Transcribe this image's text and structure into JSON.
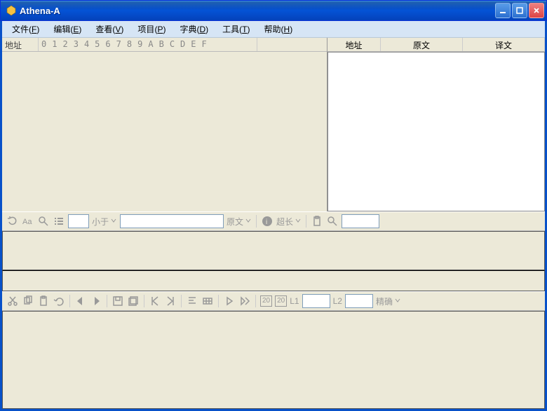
{
  "window": {
    "title": "Athena-A"
  },
  "menu": {
    "file": "文件",
    "file_k": "F",
    "edit": "编辑",
    "edit_k": "E",
    "view": "查看",
    "view_k": "V",
    "project": "项目",
    "project_k": "P",
    "dict": "字典",
    "dict_k": "D",
    "tools": "工具",
    "tools_k": "T",
    "help": "帮助",
    "help_k": "H"
  },
  "hex": {
    "address": "地址",
    "cols": [
      "0",
      "1",
      "2",
      "3",
      "4",
      "5",
      "6",
      "7",
      "8",
      "9",
      "A",
      "B",
      "C",
      "D",
      "E",
      "F"
    ]
  },
  "table": {
    "addr": "地址",
    "src": "原文",
    "dst": "译文"
  },
  "tb1": {
    "less_than": "小于",
    "src_dd": "原文",
    "overlong": "超长",
    "search_val": "",
    "filter_val": "",
    "num_val": ""
  },
  "tb2": {
    "badge1": "20",
    "badge2": "20",
    "L1": "L1",
    "L2": "L2",
    "l1_val": "",
    "l2_val": "",
    "precision": "精确"
  }
}
